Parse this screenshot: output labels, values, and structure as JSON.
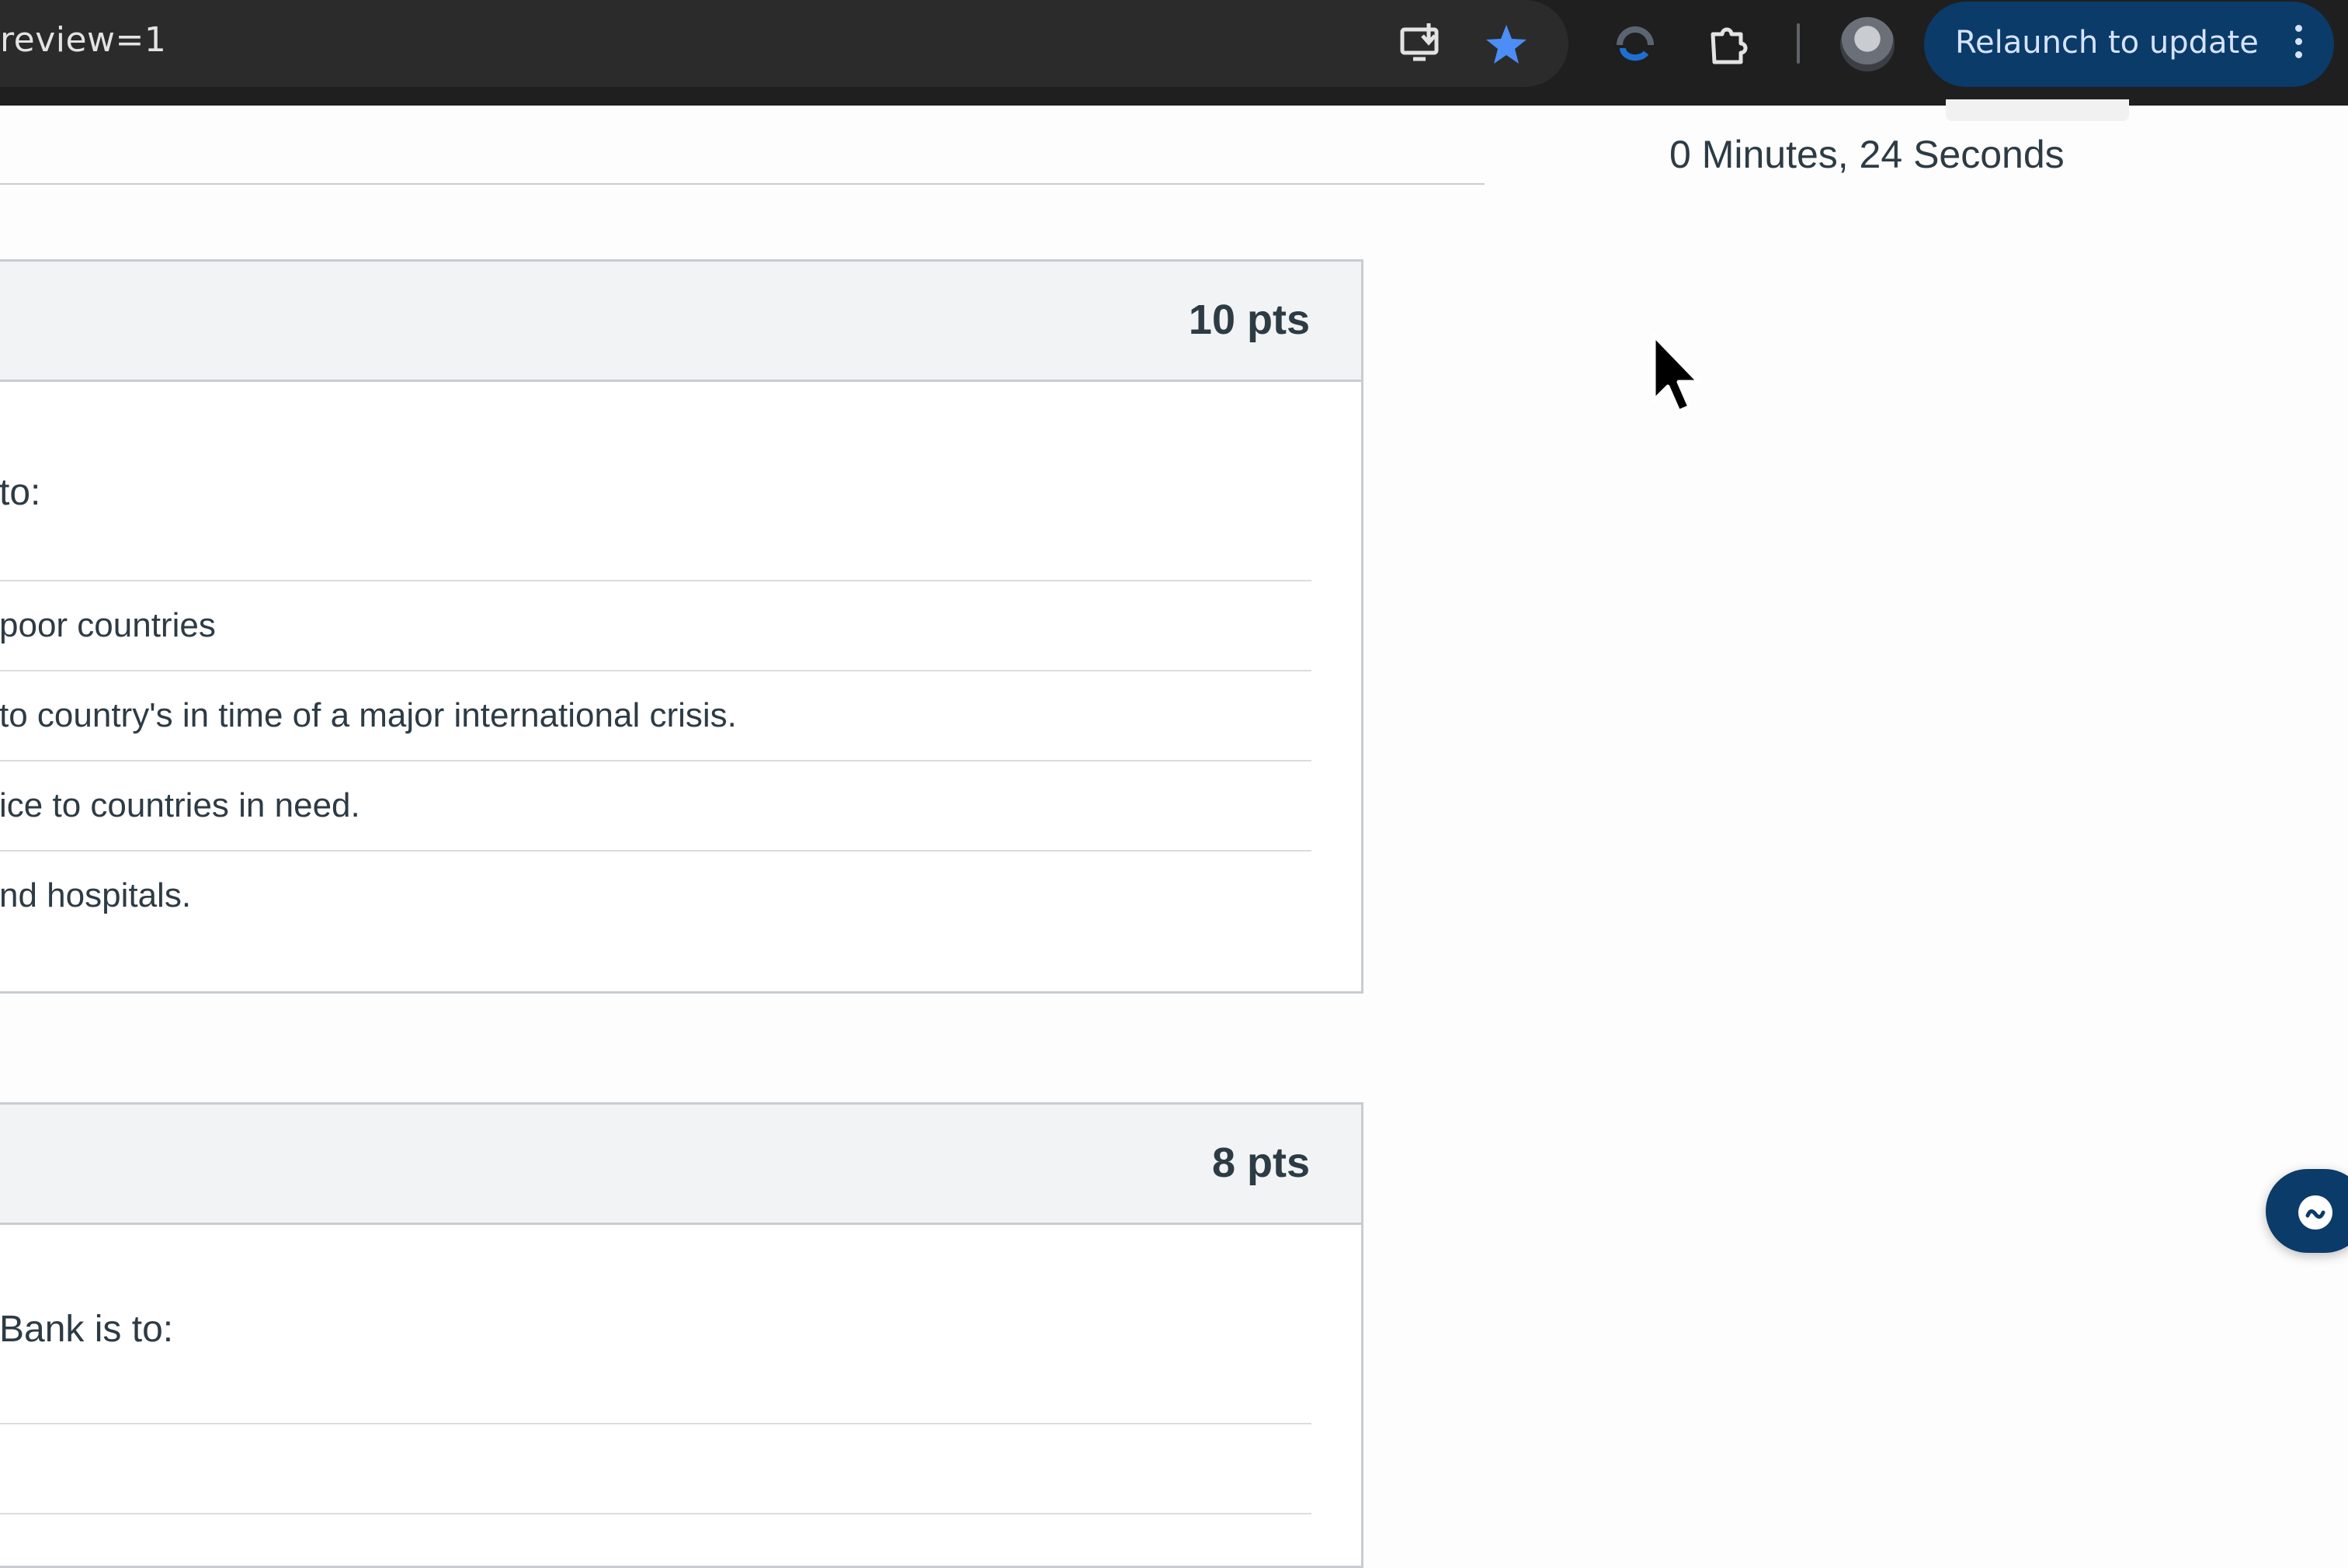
{
  "browser": {
    "url_fragment": "review=1",
    "relaunch_label": "Relaunch to update",
    "icons": [
      "install-app-icon",
      "star-icon",
      "extension-shield-icon",
      "puzzle-extensions-icon",
      "profile-avatar",
      "more-vert-icon"
    ],
    "accent_color": "#0b3b69",
    "star_color": "#4c8df6"
  },
  "quiz": {
    "timer_text": "0 Minutes, 24 Seconds",
    "questions": [
      {
        "points": "10 pts",
        "text": "to:",
        "answers": [
          "poor countries",
          "to country's in time of a major international crisis.",
          "ice to countries in need.",
          "nd hospitals."
        ]
      },
      {
        "points": "8 pts",
        "text": "Bank is to:",
        "answers": [
          "",
          ""
        ]
      }
    ]
  },
  "floating_widget": {
    "icon": "chat-assistant-icon"
  }
}
